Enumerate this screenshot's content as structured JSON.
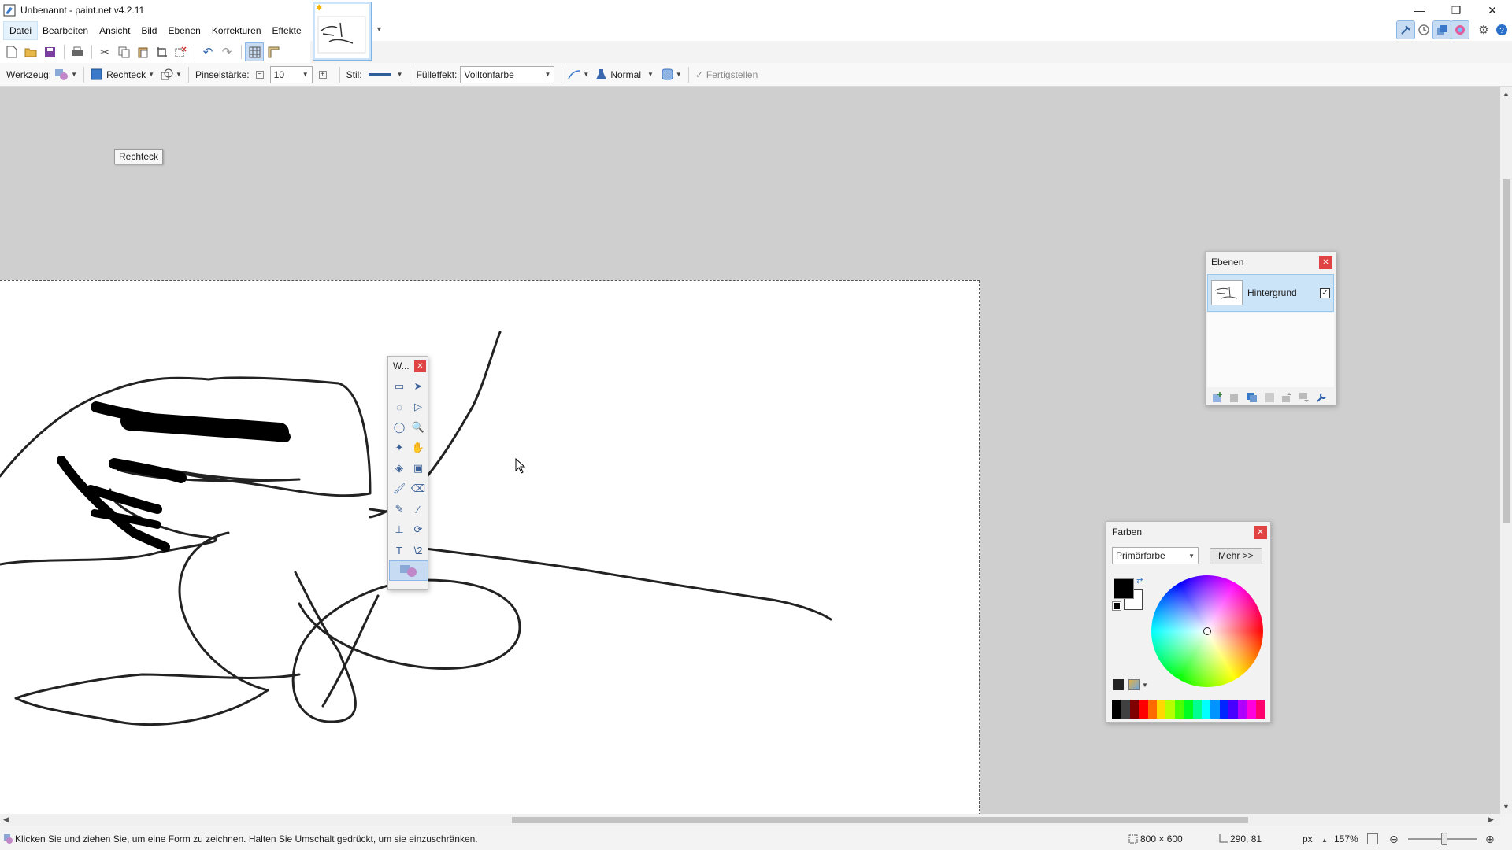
{
  "window": {
    "title": "Unbenannt - paint.net v4.2.11"
  },
  "menu": {
    "items": [
      "Datei",
      "Bearbeiten",
      "Ansicht",
      "Bild",
      "Ebenen",
      "Korrekturen",
      "Effekte"
    ]
  },
  "toolbar": {
    "werkzeug_label": "Werkzeug:",
    "shape_label": "Rechteck",
    "brush_width_label": "Pinselstärke:",
    "brush_width_value": "10",
    "style_label": "Stil:",
    "fill_label": "Fülleffekt:",
    "fill_value": "Volltonfarbe",
    "blend_mode": "Normal",
    "finish_label": "Fertigstellen"
  },
  "canvas": {
    "tooltip": "Rechteck"
  },
  "tools_window": {
    "title": "W...",
    "tools": [
      {
        "name": "rectangle-select-tool-icon",
        "glyph": "▭"
      },
      {
        "name": "move-selection-tool-icon",
        "glyph": "➤"
      },
      {
        "name": "lasso-select-tool-icon",
        "glyph": "◌"
      },
      {
        "name": "move-selected-tool-icon",
        "glyph": "▷"
      },
      {
        "name": "ellipse-select-tool-icon",
        "glyph": "◯"
      },
      {
        "name": "zoom-tool-icon",
        "glyph": "🔍"
      },
      {
        "name": "magic-wand-tool-icon",
        "glyph": "✦"
      },
      {
        "name": "pan-tool-icon",
        "glyph": "✋"
      },
      {
        "name": "paint-bucket-tool-icon",
        "glyph": "◈"
      },
      {
        "name": "gradient-tool-icon",
        "glyph": "▣"
      },
      {
        "name": "paintbrush-tool-icon",
        "glyph": "🖌"
      },
      {
        "name": "eraser-tool-icon",
        "glyph": "⌫"
      },
      {
        "name": "pencil-tool-icon",
        "glyph": "✎"
      },
      {
        "name": "color-picker-tool-icon",
        "glyph": "⁄"
      },
      {
        "name": "clone-stamp-tool-icon",
        "glyph": "⊥"
      },
      {
        "name": "recolor-tool-icon",
        "glyph": "⟳"
      },
      {
        "name": "text-tool-icon",
        "glyph": "T"
      },
      {
        "name": "line-curve-tool-icon",
        "glyph": "\\2"
      }
    ],
    "selected_tool": "shapes-tool-icon"
  },
  "layers": {
    "title": "Ebenen",
    "items": [
      {
        "name": "Hintergrund",
        "visible": true
      }
    ]
  },
  "colors": {
    "title": "Farben",
    "mode": "Primärfarbe",
    "more_label": "Mehr >>",
    "primary": "#000000",
    "secondary": "#ffffff",
    "palette": [
      "#000000",
      "#404040",
      "#7f0000",
      "#ff0000",
      "#ff6a00",
      "#ffd800",
      "#b6ff00",
      "#4cff00",
      "#00ff21",
      "#00ff90",
      "#00ffff",
      "#0094ff",
      "#0026ff",
      "#4800ff",
      "#b200ff",
      "#ff00dc",
      "#ff006e"
    ]
  },
  "status": {
    "hint": "Klicken Sie und ziehen Sie, um eine Form zu zeichnen. Halten Sie Umschalt gedrückt, um sie einzuschränken.",
    "image_size": "800 × 600",
    "cursor_pos": "290, 81",
    "unit": "px",
    "zoom": "157%"
  }
}
